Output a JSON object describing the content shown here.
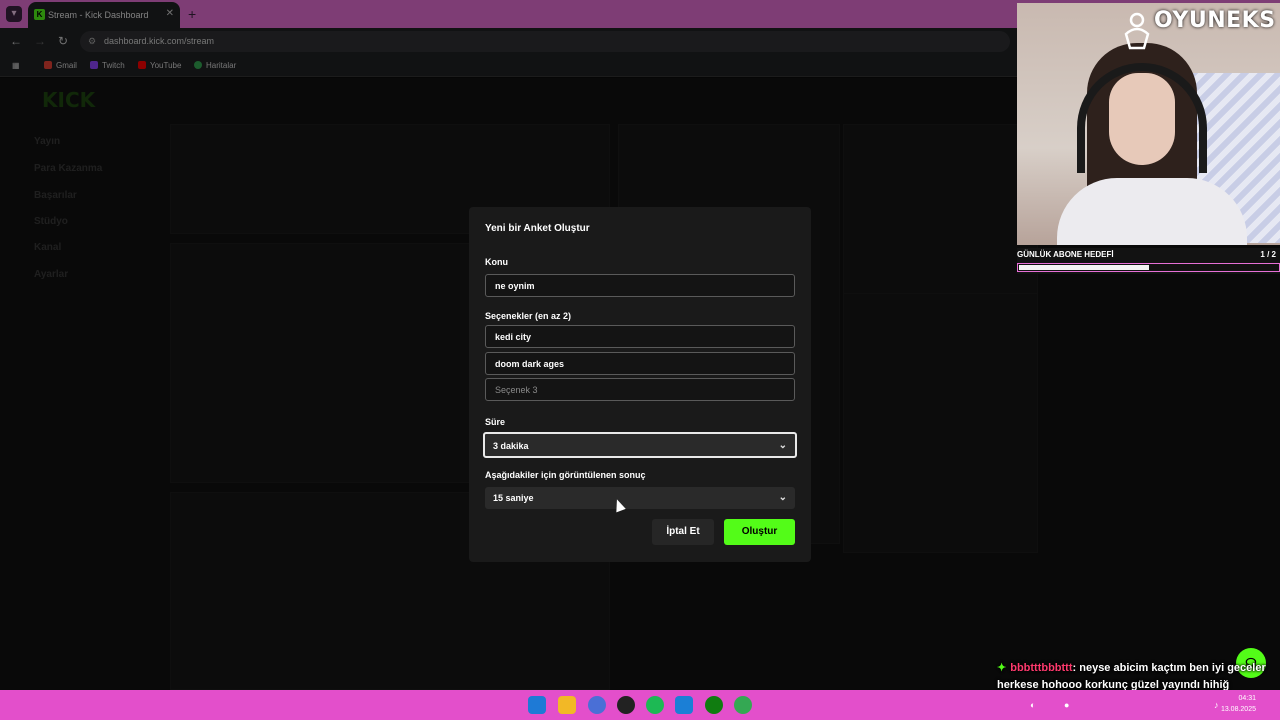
{
  "browser": {
    "tab_title": "Stream - Kick Dashboard",
    "url": "dashboard.kick.com/stream",
    "bookmarks": [
      "Gmail",
      "Twitch",
      "YouTube",
      "Haritalar"
    ]
  },
  "dashboard": {
    "logo": "KICK",
    "sidebar": [
      "Yayın",
      "Para Kazanma",
      "Başarılar",
      "Stüdyo",
      "Kanal",
      "Ayarlar"
    ]
  },
  "modal": {
    "title": "Yeni bir Anket Oluştur",
    "topic_label": "Konu",
    "topic_value": "ne oynim",
    "options_label": "Seçenekler (en az 2)",
    "options": [
      {
        "value": "kedi city",
        "placeholder": ""
      },
      {
        "value": "doom dark ages",
        "placeholder": ""
      },
      {
        "value": "",
        "placeholder": "Seçenek 3"
      }
    ],
    "duration_label": "Süre",
    "duration_value": "3 dakika",
    "result_label": "Aşağıdakiler için görüntülenen sonuç",
    "result_value": "15 saniye",
    "cancel_label": "İptal Et",
    "create_label": "Oluştur"
  },
  "overlay": {
    "brand": "OYUNEKS",
    "goal_label": "GÜNLÜK ABONE HEDEFİ",
    "goal_count": "1 / 2",
    "goal_progress": 0.5,
    "chat_user": "bbbtttbbbttt",
    "chat_message": ": neyse abicim kaçtım ben iyi geceler herkese hohooo korkunç güzel yayındı hihiğ"
  },
  "taskbar": {
    "time": "04:31",
    "date": "13.08.2025"
  },
  "colors": {
    "kick_green": "#53fc18",
    "pink_accent": "#e66fd6",
    "modal_bg": "#1a1a1a"
  }
}
